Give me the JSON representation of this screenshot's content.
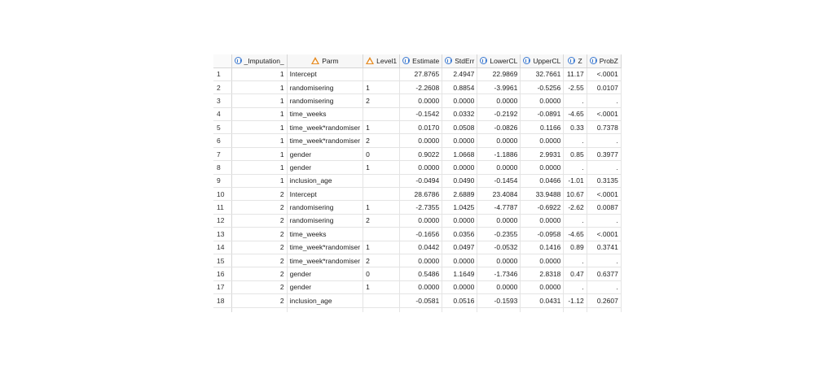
{
  "columns": [
    {
      "key": "_Imputation_",
      "label": "_Imputation_",
      "icon": "numeric-column-icon",
      "type": "num"
    },
    {
      "key": "Parm",
      "label": "Parm",
      "icon": "character-column-icon",
      "type": "txt"
    },
    {
      "key": "Level1",
      "label": "Level1",
      "icon": "character-column-icon",
      "type": "txt"
    },
    {
      "key": "Estimate",
      "label": "Estimate",
      "icon": "numeric-column-icon",
      "type": "num"
    },
    {
      "key": "StdErr",
      "label": "StdErr",
      "icon": "numeric-column-icon",
      "type": "num"
    },
    {
      "key": "LowerCL",
      "label": "LowerCL",
      "icon": "numeric-column-icon",
      "type": "num"
    },
    {
      "key": "UpperCL",
      "label": "UpperCL",
      "icon": "numeric-column-icon",
      "type": "num"
    },
    {
      "key": "Z",
      "label": "Z",
      "icon": "numeric-column-icon",
      "type": "num"
    },
    {
      "key": "ProbZ",
      "label": "ProbZ",
      "icon": "numeric-column-icon",
      "type": "num"
    }
  ],
  "rows": [
    {
      "n": "1",
      "cells": [
        "1",
        "Intercept",
        "",
        "27.8765",
        "2.4947",
        "22.9869",
        "32.7661",
        "11.17",
        "<.0001"
      ]
    },
    {
      "n": "2",
      "cells": [
        "1",
        "randomisering",
        "1",
        "-2.2608",
        "0.8854",
        "-3.9961",
        "-0.5256",
        "-2.55",
        "0.0107"
      ]
    },
    {
      "n": "3",
      "cells": [
        "1",
        "randomisering",
        "2",
        "0.0000",
        "0.0000",
        "0.0000",
        "0.0000",
        ".",
        "."
      ]
    },
    {
      "n": "4",
      "cells": [
        "1",
        "time_weeks",
        "",
        "-0.1542",
        "0.0332",
        "-0.2192",
        "-0.0891",
        "-4.65",
        "<.0001"
      ]
    },
    {
      "n": "5",
      "cells": [
        "1",
        "time_week*randomiser",
        "1",
        "0.0170",
        "0.0508",
        "-0.0826",
        "0.1166",
        "0.33",
        "0.7378"
      ]
    },
    {
      "n": "6",
      "cells": [
        "1",
        "time_week*randomiser",
        "2",
        "0.0000",
        "0.0000",
        "0.0000",
        "0.0000",
        ".",
        "."
      ]
    },
    {
      "n": "7",
      "cells": [
        "1",
        "gender",
        "0",
        "0.9022",
        "1.0668",
        "-1.1886",
        "2.9931",
        "0.85",
        "0.3977"
      ]
    },
    {
      "n": "8",
      "cells": [
        "1",
        "gender",
        "1",
        "0.0000",
        "0.0000",
        "0.0000",
        "0.0000",
        ".",
        "."
      ]
    },
    {
      "n": "9",
      "cells": [
        "1",
        "inclusion_age",
        "",
        "-0.0494",
        "0.0490",
        "-0.1454",
        "0.0466",
        "-1.01",
        "0.3135"
      ]
    },
    {
      "n": "10",
      "cells": [
        "2",
        "Intercept",
        "",
        "28.6786",
        "2.6889",
        "23.4084",
        "33.9488",
        "10.67",
        "<.0001"
      ]
    },
    {
      "n": "11",
      "cells": [
        "2",
        "randomisering",
        "1",
        "-2.7355",
        "1.0425",
        "-4.7787",
        "-0.6922",
        "-2.62",
        "0.0087"
      ]
    },
    {
      "n": "12",
      "cells": [
        "2",
        "randomisering",
        "2",
        "0.0000",
        "0.0000",
        "0.0000",
        "0.0000",
        ".",
        "."
      ]
    },
    {
      "n": "13",
      "cells": [
        "2",
        "time_weeks",
        "",
        "-0.1656",
        "0.0356",
        "-0.2355",
        "-0.0958",
        "-4.65",
        "<.0001"
      ]
    },
    {
      "n": "14",
      "cells": [
        "2",
        "time_week*randomiser",
        "1",
        "0.0442",
        "0.0497",
        "-0.0532",
        "0.1416",
        "0.89",
        "0.3741"
      ]
    },
    {
      "n": "15",
      "cells": [
        "2",
        "time_week*randomiser",
        "2",
        "0.0000",
        "0.0000",
        "0.0000",
        "0.0000",
        ".",
        "."
      ]
    },
    {
      "n": "16",
      "cells": [
        "2",
        "gender",
        "0",
        "0.5486",
        "1.1649",
        "-1.7346",
        "2.8318",
        "0.47",
        "0.6377"
      ]
    },
    {
      "n": "17",
      "cells": [
        "2",
        "gender",
        "1",
        "0.0000",
        "0.0000",
        "0.0000",
        "0.0000",
        ".",
        "."
      ]
    },
    {
      "n": "18",
      "cells": [
        "2",
        "inclusion_age",
        "",
        "-0.0581",
        "0.0516",
        "-0.1593",
        "0.0431",
        "-1.12",
        "0.2607"
      ]
    }
  ],
  "colors": {
    "numeric_icon": "#3d7bd3",
    "character_icon": "#e68a1f",
    "header_bg": "#f7f7f7",
    "grid_line": "#e4e4e4"
  }
}
